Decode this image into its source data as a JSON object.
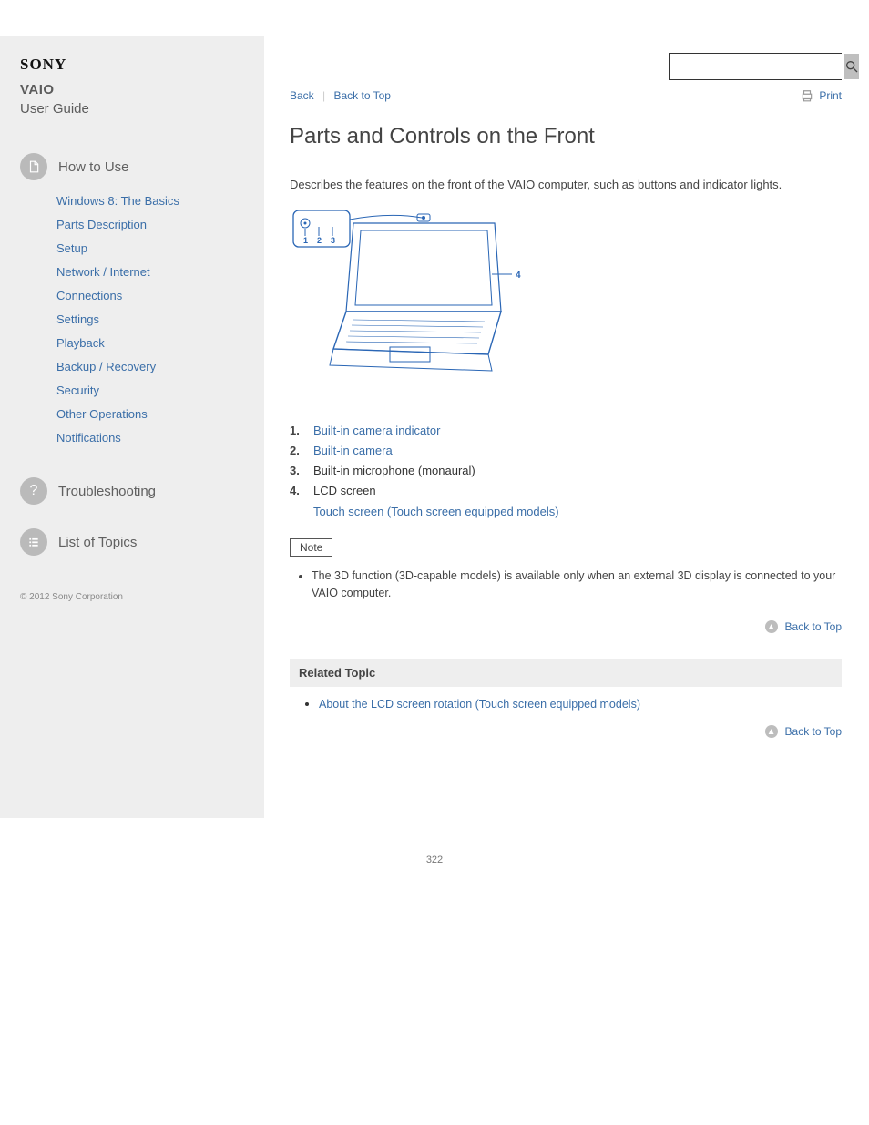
{
  "brand": "SONY",
  "product_line1": "VAIO",
  "product_line2": "User Guide",
  "search": {
    "placeholder": "",
    "button_aria": "Search"
  },
  "crumb": {
    "back": "Back",
    "back_top": "Back to Top",
    "print": "Print"
  },
  "sidebar": {
    "howto_title": "How to Use",
    "howto_items": [
      "Windows 8: The Basics",
      "Parts Description",
      "Setup",
      "Network / Internet",
      "Connections",
      "Settings",
      "Playback",
      "Backup / Recovery",
      "Security",
      "Other Operations",
      "Notifications"
    ],
    "troubleshoot": "Troubleshooting",
    "contents": "List of Topics"
  },
  "copyright": "© 2012 Sony Corporation",
  "article": {
    "title": "Parts and Controls on the Front",
    "lead": "Describes the features on the front of the VAIO computer, such as buttons and indicator lights.",
    "list": [
      {
        "text": "Built-in camera indicator",
        "href": "#"
      },
      {
        "text": "Built-in camera",
        "href": "#"
      },
      {
        "text": "Built-in microphone (monaural)"
      },
      {
        "text": "LCD screen"
      },
      {
        "text": "Touch screen (Touch screen equipped models)",
        "href": "#"
      }
    ],
    "note_label": "Note",
    "note_items": [
      "The 3D function (3D-capable models) is available only when an external 3D display is connected to your VAIO computer."
    ],
    "related_head": "Related Topic",
    "related_items": [
      {
        "text": "About the LCD screen rotation (Touch screen equipped models)",
        "href": "#"
      }
    ]
  },
  "page_number": "322"
}
